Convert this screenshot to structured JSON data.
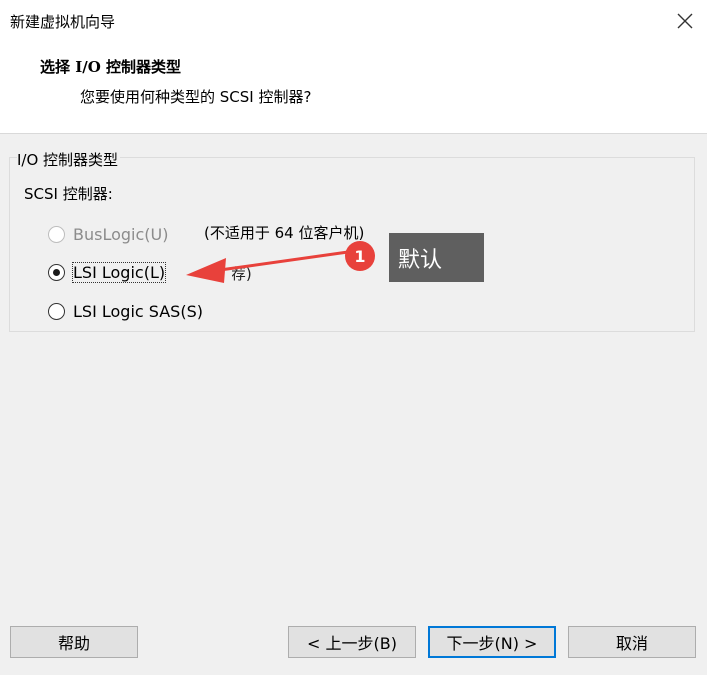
{
  "window": {
    "title": "新建虚拟机向导",
    "close_icon": "close-icon"
  },
  "page": {
    "heading": "选择 I/O 控制器类型",
    "subheading": "您要使用何种类型的 SCSI 控制器?"
  },
  "group": {
    "legend": "I/O 控制器类型",
    "scsi_label": "SCSI 控制器:",
    "options": [
      {
        "label": "BusLogic(U)",
        "note": "(不适用于 64 位客户机)",
        "enabled": false,
        "selected": false
      },
      {
        "label": "LSI Logic(L)",
        "note": "(推荐)",
        "enabled": true,
        "selected": true
      },
      {
        "label": "LSI Logic SAS(S)",
        "note": "",
        "enabled": true,
        "selected": false
      }
    ]
  },
  "annotation": {
    "number": "1",
    "text": "默认",
    "color": "#e8413b"
  },
  "buttons": {
    "help": "帮助",
    "back": "< 上一步(B)",
    "next": "下一步(N) >",
    "cancel": "取消"
  },
  "colors": {
    "accent": "#0078d7",
    "annotation_red": "#e8413b",
    "tooltip_bg": "#5f5f5f"
  }
}
